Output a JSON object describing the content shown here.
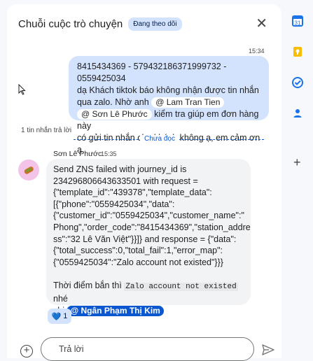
{
  "thread": {
    "title": "Chuỗi cuộc trò chuyện",
    "follow_badge": "Đang theo dõi"
  },
  "message1": {
    "time": "15:34",
    "line1": "8415434369 - 579432186371999732  - 0559425034",
    "line2": "dạ Khách tiktok báo không nhận được tin nhắn",
    "line3_before": "qua zalo. Nhờ anh ",
    "mention1": "@ Lam Tran Tien",
    "mention2": "@ Sơn Lê Phước",
    "line4_after": " kiểm tra giúp em đơn hàng này",
    "line5": "có gửi tin nhắn cho khách không ạ, em cảm ơn ạ."
  },
  "replies": {
    "count_label": "1 tin nhắn trả lời",
    "unread_label": "Chưa đọc"
  },
  "message2": {
    "sender": "Sơn Lê Phước",
    "time": "15:35",
    "lines": [
      "Send ZNS failed with journey_id is",
      "234296806643633501 with request =",
      "{\"template_id\":\"439378\",\"template_data\":",
      "[{\"phone\":\"0559425034\",\"data\":",
      "{\"customer_id\":\"0559425034\",\"customer_name\":\"",
      "Phong\",\"order_code\":\"8415434369\",\"station_addre",
      "ss\":\"32 Lê Văn Việt\"}}]} and response = {\"data\":",
      "{\"total_success\":0,\"total_fail\":1,\"error_map\":",
      "{\"0559425034\":\"Zalo account not existed\"}}}"
    ],
    "footer_before": "Thời điểm bắn thì ",
    "footer_code": "Zalo account not existed",
    "footer_after": " nhé",
    "footer_line2": "chị ",
    "mention": "@ Ngân Phạm Thị Kim",
    "reaction_count": "1",
    "reaction_icon": "blue-heart-icon"
  },
  "composer": {
    "placeholder": "Trả lời"
  },
  "rail": {
    "icons": [
      "calendar-icon",
      "keep-icon",
      "tasks-icon",
      "contacts-icon",
      "add-icon"
    ]
  }
}
